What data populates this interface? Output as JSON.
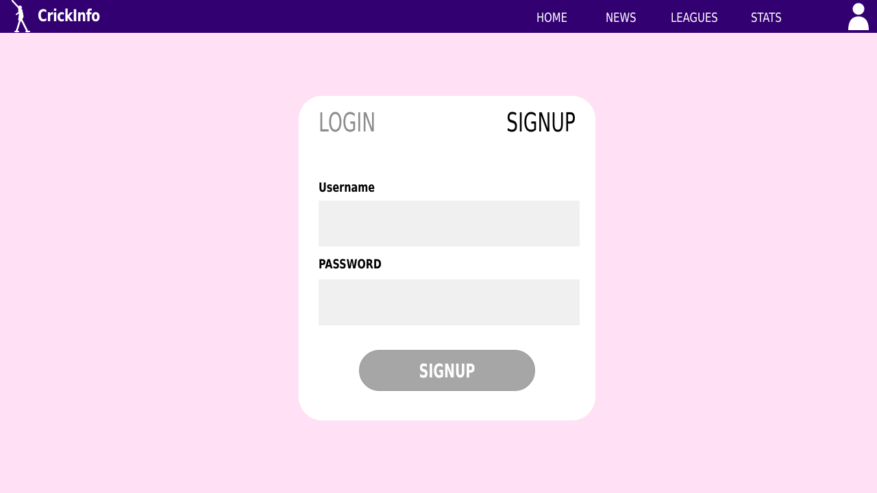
{
  "header": {
    "brand": "CrickInfo",
    "logo_icon": "cricket-batsman-icon",
    "nav": [
      {
        "label": "HOME"
      },
      {
        "label": "NEWS"
      },
      {
        "label": "LEAGUES"
      },
      {
        "label": "STATS"
      }
    ],
    "user_icon": "user-icon"
  },
  "auth_card": {
    "tabs": {
      "login": "LOGIN",
      "signup": "SIGNUP"
    },
    "active_tab": "SIGNUP",
    "fields": {
      "username": {
        "label": "Username",
        "value": "",
        "placeholder": ""
      },
      "password": {
        "label": "PASSWORD",
        "value": "",
        "placeholder": ""
      }
    },
    "submit_label": "SIGNUP"
  },
  "colors": {
    "background": "#ffe0f4",
    "header": "#330072",
    "card": "#ffffff",
    "input_bg": "#f0f0f0",
    "button": "#a6a6a6",
    "inactive_tab": "#8c8c8c"
  }
}
